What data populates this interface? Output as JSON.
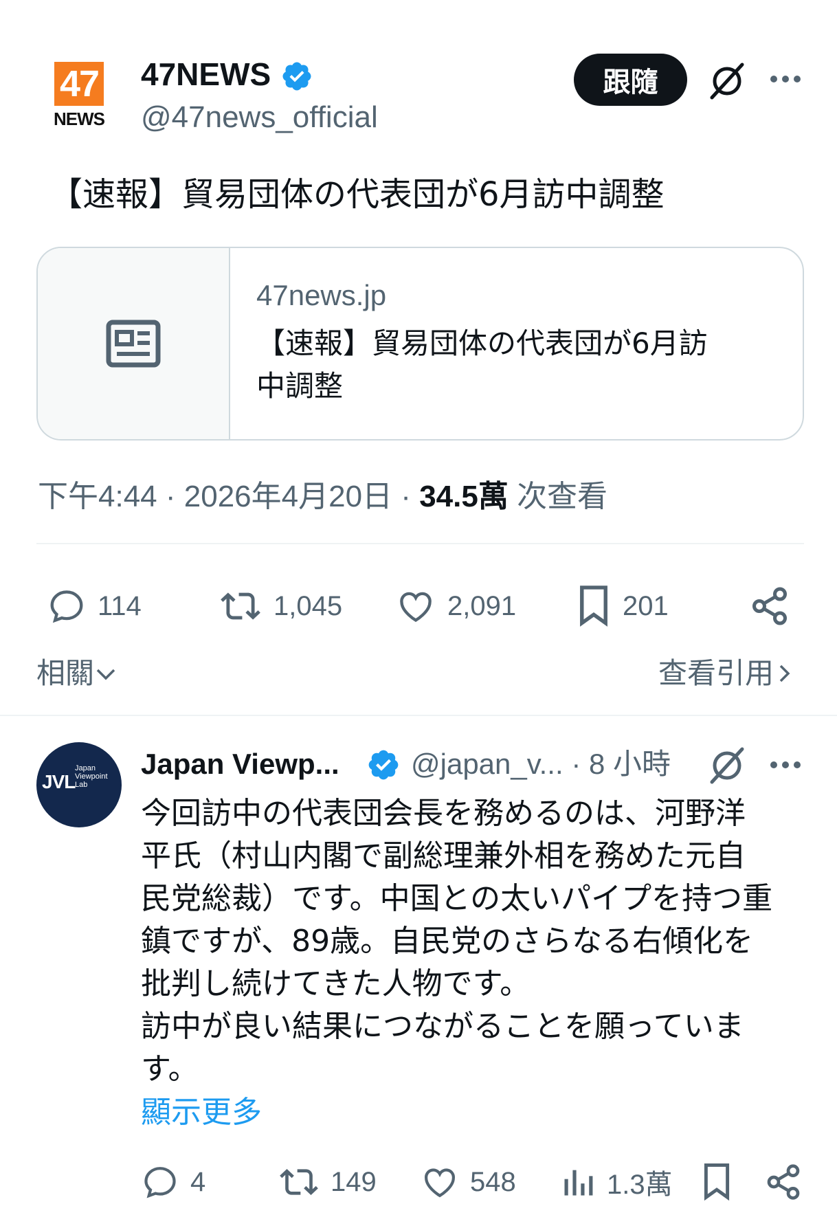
{
  "main_tweet": {
    "logo_text_top": "47",
    "logo_text_bottom": "NEWS",
    "author_name": "47NEWS",
    "author_handle": "@47news_official",
    "follow_label": "跟隨",
    "text": "【速報】貿易団体の代表団が6月訪中調整",
    "card": {
      "domain": "47news.jp",
      "title_line1": "【速報】貿易団体の代表団が6月訪",
      "title_line2": "中調整"
    },
    "time": "下午4:44",
    "date": "2026年4月20日",
    "views_count": "34.5萬",
    "views_label": "次查看",
    "actions": {
      "replies": "114",
      "reposts": "1,045",
      "likes": "2,091",
      "bookmarks": "201"
    },
    "related_label": "相關",
    "quotes_label": "查看引用"
  },
  "reply": {
    "avatar_text": "JVL",
    "avatar_small": "Japan Viewpoint Lab",
    "author_name": "Japan Viewp...",
    "author_handle": "@japan_v...",
    "time": "· 8 小時",
    "lines": [
      "今回訪中の代表団会長を務めるのは、河野洋",
      "平氏（村山内閣で副総理兼外相を務めた元自",
      "民党総裁）です。中国との太いパイプを持つ重",
      "鎮ですが、89歳。自民党のさらなる右傾化を",
      "批判し続けてきた人物です。",
      "訪中が良い結果につながることを願っていま",
      "す。"
    ],
    "show_more": "顯示更多",
    "actions": {
      "replies": "4",
      "reposts": "149",
      "likes": "548",
      "views": "1.3萬"
    }
  },
  "colors": {
    "text": "#0f1419",
    "secondary": "#536471",
    "accent": "#1d9bf0",
    "brand_orange": "#f57c1f",
    "avatar_navy": "#13284d"
  }
}
